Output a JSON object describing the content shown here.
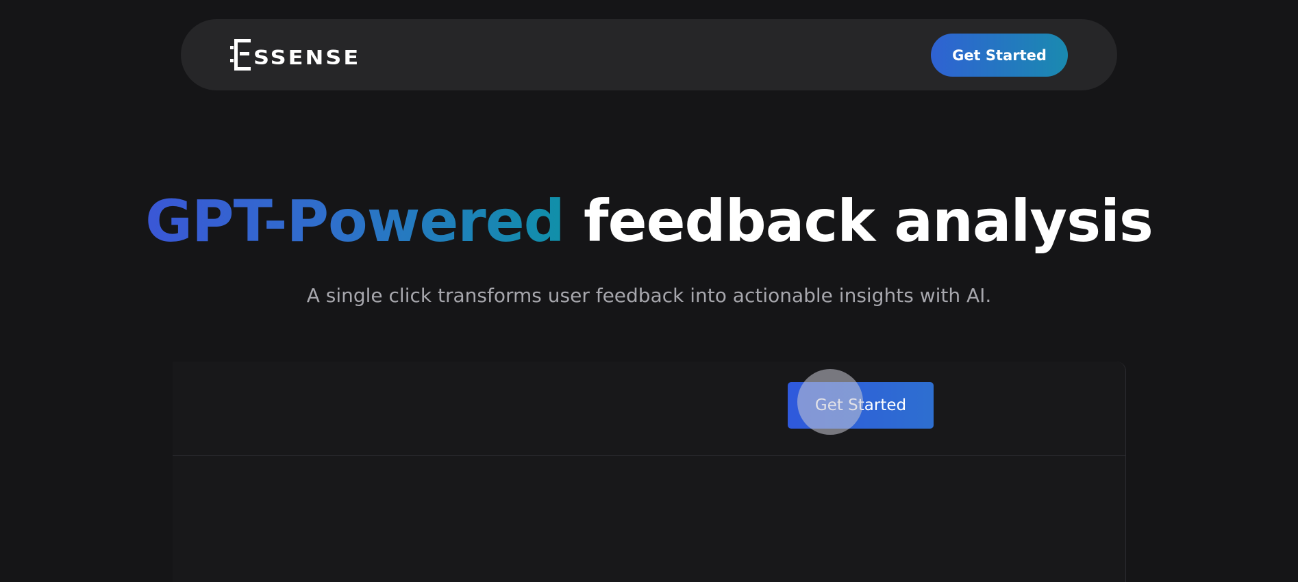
{
  "navbar": {
    "logo_text": "SSENSE",
    "logo_alt": "Essense",
    "cta_label": "Get Started"
  },
  "hero": {
    "title_highlight": "GPT-Powered",
    "title_rest": " feedback analysis",
    "subtitle": "A single click transforms user feedback into actionable insights with AI."
  },
  "panel": {
    "cta_label": "Get Started"
  },
  "colors": {
    "background": "#151517",
    "navbar": "#262628",
    "accent_blue": "#2f62d3",
    "accent_teal": "#1a8ab0",
    "subtitle": "#a7a7ad"
  },
  "icons": {
    "logo": "essense-logo-icon",
    "cursor": "click-ripple-icon"
  }
}
